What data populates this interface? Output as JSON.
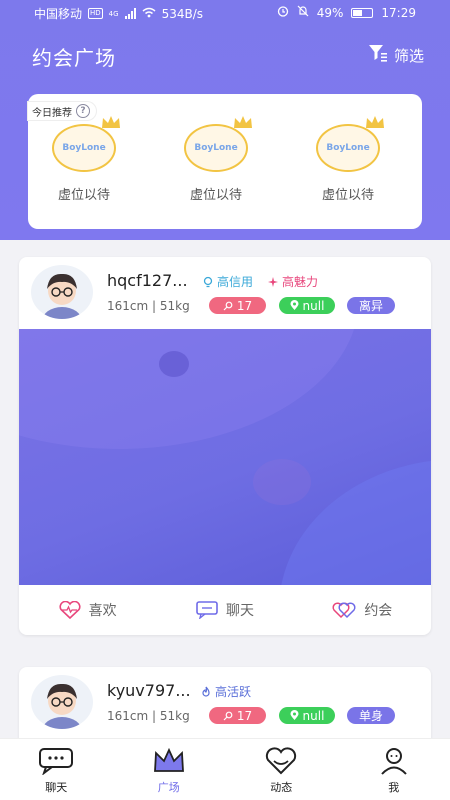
{
  "status_bar": {
    "carrier": "中国移动",
    "hd": "HD",
    "network": "4G",
    "speed": "534B/s",
    "battery": "49%",
    "time": "17:29"
  },
  "header": {
    "title": "约会广场",
    "filter_label": "筛选"
  },
  "recommend": {
    "tag_label": "今日推荐",
    "items": [
      {
        "logo": "BoyLone",
        "label": "虚位以待"
      },
      {
        "logo": "BoyLone",
        "label": "虚位以待"
      },
      {
        "logo": "BoyLone",
        "label": "虚位以待"
      }
    ]
  },
  "cards": [
    {
      "name": "hqcf127...",
      "meta": "161cm | 51kg",
      "tags": [
        {
          "label": "高信用",
          "color": "#3aa8d8"
        },
        {
          "label": "高魅力",
          "color": "#e8467c"
        }
      ],
      "pills": [
        {
          "label": "17",
          "color": "#f06880"
        },
        {
          "label": "null",
          "color": "#3ccf5a"
        },
        {
          "label": "离异",
          "color": "#7a74e8"
        }
      ],
      "actions": {
        "like": "喜欢",
        "chat": "聊天",
        "date": "约会"
      }
    },
    {
      "name": "kyuv797...",
      "meta": "161cm | 51kg",
      "tags": [
        {
          "label": "高活跃",
          "color": "#5a6fd8"
        }
      ],
      "pills": [
        {
          "label": "17",
          "color": "#f06880"
        },
        {
          "label": "null",
          "color": "#3ccf5a"
        },
        {
          "label": "单身",
          "color": "#7a74e8"
        }
      ]
    }
  ],
  "nav": [
    {
      "label": "聊天",
      "icon": "chat-icon"
    },
    {
      "label": "广场",
      "icon": "crown-icon"
    },
    {
      "label": "动态",
      "icon": "heart-icon"
    },
    {
      "label": "我",
      "icon": "person-icon"
    }
  ],
  "colors": {
    "accent": "#7d79ec",
    "like": "#e8467c",
    "chat": "#6f6be8",
    "date": "#6f6be8"
  }
}
